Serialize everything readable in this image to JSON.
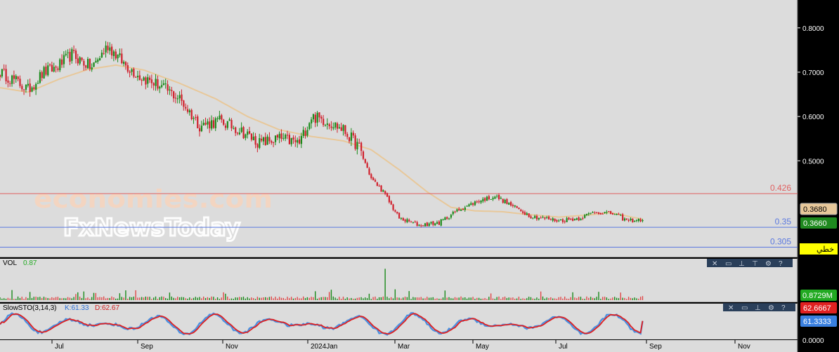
{
  "colors": {
    "background": "#dcdcdc",
    "axis_background": "#000000",
    "up_candle": "#1a8a1a",
    "down_candle": "#d0202c",
    "ma_line": "#e8c89a",
    "level_red": "#e06060",
    "level_blue": "#5a78e0",
    "volume_bar": "#e04848",
    "sto_k": "#4a90e0",
    "sto_d": "#e02020",
    "vol_label_value": "#22aa22",
    "sto_k_label": "#2b6fd6",
    "sto_d_label": "#d02020",
    "badge_price": "#1f8a1f",
    "badge_ma": "#e8c89a",
    "badge_d": "#e02020",
    "badge_k": "#3a80e0",
    "badge_vol": "#22aa22",
    "badge_yellow": "#ffff00"
  },
  "watermark": {
    "line1": "economies.com",
    "line2": "FxNewsToday"
  },
  "price_axis": {
    "ticks": [
      "0.8000",
      "0.7000",
      "0.6000",
      "0.5000"
    ],
    "badge_ma": "0.3680",
    "badge_price": "0.3660",
    "badge_label": "خطي"
  },
  "levels": [
    {
      "label": "0.426",
      "value": 0.426,
      "color": "red"
    },
    {
      "label": "0.35",
      "value": 0.35,
      "color": "blue"
    },
    {
      "label": "0.305",
      "value": 0.305,
      "color": "blue"
    }
  ],
  "volume_panel": {
    "label": "VOL",
    "value": "0.87",
    "badge": "0.8729M",
    "tools": [
      "close-icon",
      "restore-icon",
      "up-arrow-icon",
      "down-arrow-icon",
      "settings-icon",
      "help-icon"
    ]
  },
  "sto_panel": {
    "label": "SlowSTO(3,14,3)",
    "k_label": "K:61.33",
    "d_label": "D:62.67",
    "badge_d": "62.6667",
    "badge_k": "61.3333",
    "tools": [
      "close-icon",
      "restore-icon",
      "up-arrow-icon",
      "settings-icon",
      "help-icon"
    ]
  },
  "time_axis": {
    "labels": [
      "Jul",
      "Sep",
      "Nov",
      "2024Jan",
      "Mar",
      "May",
      "Jul",
      "Sep",
      "Nov"
    ],
    "bottom_value": "0.0000"
  },
  "chart_data": {
    "type": "candlestick",
    "price_ylim": [
      0.29,
      0.855
    ],
    "volume_ylim": [
      0,
      7
    ],
    "sto_ylim": [
      0,
      100
    ],
    "months": [
      "Jul",
      "Sep",
      "Nov",
      "2024Jan",
      "Mar",
      "May",
      "Jul",
      "Sep",
      "Nov"
    ],
    "close_anchors": [
      [
        0,
        0.7
      ],
      [
        8,
        0.68
      ],
      [
        14,
        0.66
      ],
      [
        22,
        0.7
      ],
      [
        28,
        0.71
      ],
      [
        36,
        0.74
      ],
      [
        46,
        0.71
      ],
      [
        54,
        0.76
      ],
      [
        62,
        0.72
      ],
      [
        70,
        0.69
      ],
      [
        80,
        0.67
      ],
      [
        90,
        0.64
      ],
      [
        100,
        0.58
      ],
      [
        110,
        0.59
      ],
      [
        120,
        0.57
      ],
      [
        130,
        0.54
      ],
      [
        140,
        0.55
      ],
      [
        150,
        0.54
      ],
      [
        156,
        0.6
      ],
      [
        164,
        0.59
      ],
      [
        172,
        0.57
      ],
      [
        180,
        0.53
      ],
      [
        186,
        0.46
      ],
      [
        192,
        0.43
      ],
      [
        200,
        0.37
      ],
      [
        210,
        0.355
      ],
      [
        220,
        0.36
      ],
      [
        230,
        0.39
      ],
      [
        240,
        0.41
      ],
      [
        248,
        0.42
      ],
      [
        256,
        0.4
      ],
      [
        266,
        0.375
      ],
      [
        280,
        0.365
      ],
      [
        290,
        0.37
      ],
      [
        298,
        0.385
      ],
      [
        308,
        0.38
      ],
      [
        314,
        0.365
      ],
      [
        322,
        0.367
      ]
    ],
    "ma_anchors": [
      [
        0,
        0.665
      ],
      [
        14,
        0.655
      ],
      [
        30,
        0.685
      ],
      [
        44,
        0.706
      ],
      [
        58,
        0.716
      ],
      [
        72,
        0.705
      ],
      [
        90,
        0.675
      ],
      [
        108,
        0.64
      ],
      [
        124,
        0.6
      ],
      [
        140,
        0.57
      ],
      [
        156,
        0.555
      ],
      [
        172,
        0.545
      ],
      [
        186,
        0.525
      ],
      [
        200,
        0.48
      ],
      [
        214,
        0.43
      ],
      [
        226,
        0.395
      ],
      [
        238,
        0.387
      ],
      [
        252,
        0.385
      ],
      [
        266,
        0.378
      ],
      [
        280,
        0.373
      ],
      [
        296,
        0.378
      ],
      [
        306,
        0.383
      ],
      [
        322,
        0.368
      ]
    ],
    "volume_spike": {
      "index": 193,
      "value": 6.8
    },
    "volume_last": 0.8729,
    "sto_last": {
      "k": 61.33,
      "d": 62.67
    }
  }
}
